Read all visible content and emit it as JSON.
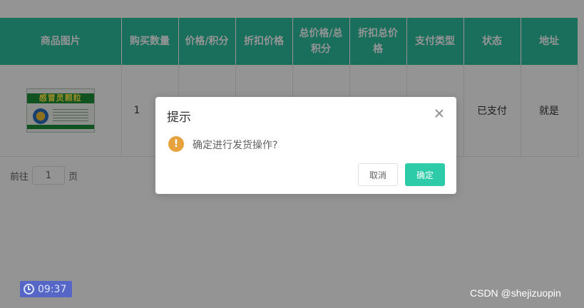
{
  "table": {
    "headers": [
      "商品图片",
      "购买数量",
      "价格/积分",
      "折扣价格",
      "总价格/总积分",
      "折扣总价格",
      "支付类型",
      "状态",
      "地址"
    ],
    "row": {
      "product_image_text": "感冒灵颗粒",
      "quantity": "1",
      "price": "",
      "discount_price": "",
      "total": "",
      "discount_total": "",
      "pay_type": "",
      "status": "已支付",
      "address": "就是"
    }
  },
  "pager": {
    "goto_label": "前往",
    "page_value": "1",
    "page_suffix": "页"
  },
  "dialog": {
    "title": "提示",
    "message": "确定进行发货操作?",
    "cancel_label": "取消",
    "confirm_label": "确定",
    "warning_glyph": "!"
  },
  "timer": {
    "time": "09:37"
  },
  "watermark": "CSDN @shejizuopin",
  "colors": {
    "header": "#2dbf9f",
    "confirm": "#2dcba7",
    "warning": "#e6a23c",
    "timer": "#5566c6"
  }
}
